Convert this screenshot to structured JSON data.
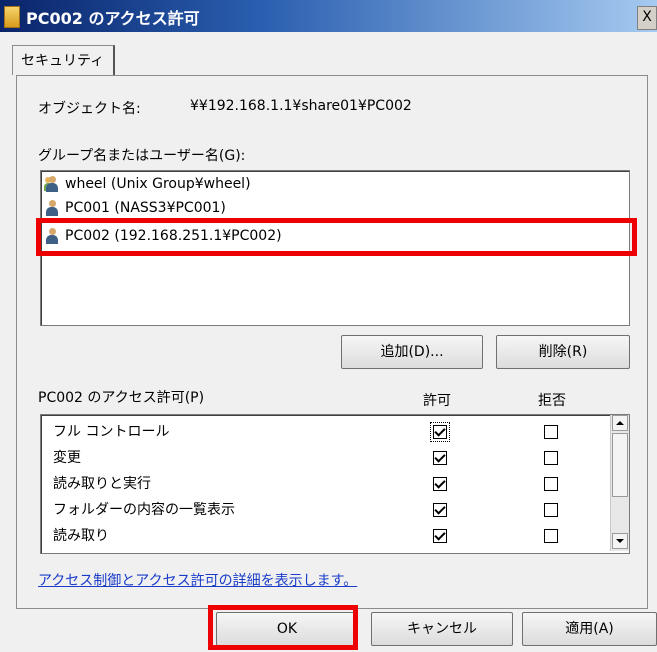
{
  "window": {
    "title": "PC002 のアクセス許可",
    "close_label": "X"
  },
  "tabs": [
    {
      "label": "セキュリティ"
    }
  ],
  "object_name": {
    "label": "オブジェクト名:",
    "value": "¥¥192.168.1.1¥share01¥PC002"
  },
  "group_list": {
    "label": "グループ名またはユーザー名(G):",
    "items": [
      {
        "name": "wheel (Unix Group¥wheel)",
        "icon": "group-icon"
      },
      {
        "name": "PC001 (NASS3¥PC001)",
        "icon": "user-icon"
      },
      {
        "name": "PC002 (192.168.251.1¥PC002)",
        "icon": "user-icon"
      }
    ]
  },
  "buttons": {
    "add": "追加(D)...",
    "remove": "削除(R)",
    "ok": "OK",
    "cancel": "キャンセル",
    "apply": "適用(A)"
  },
  "permissions": {
    "label": "PC002 のアクセス許可(P)",
    "allow_header": "許可",
    "deny_header": "拒否",
    "rows": [
      {
        "name": "フル コントロール",
        "allow": true,
        "deny": false
      },
      {
        "name": "変更",
        "allow": true,
        "deny": false
      },
      {
        "name": "読み取りと実行",
        "allow": true,
        "deny": false
      },
      {
        "name": "フォルダーの内容の一覧表示",
        "allow": true,
        "deny": false
      },
      {
        "name": "読み取り",
        "allow": true,
        "deny": false
      }
    ]
  },
  "help_link": "アクセス制御とアクセス許可の詳細を表示します。",
  "highlight_color": "#ee0000"
}
